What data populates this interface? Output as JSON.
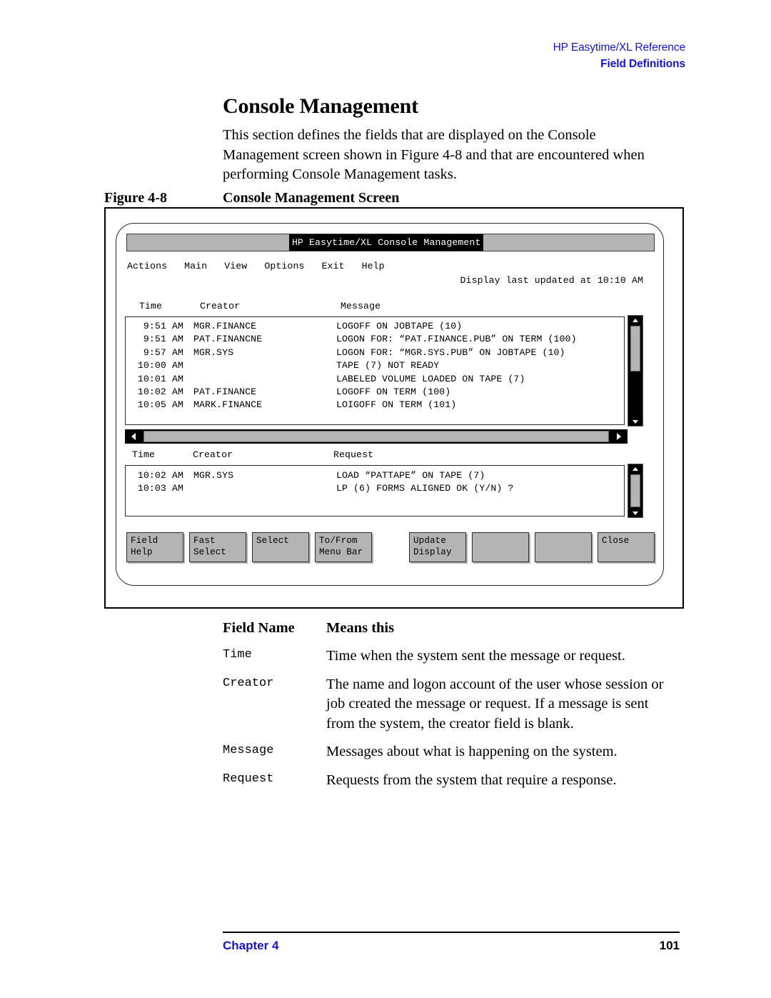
{
  "header": {
    "line1": "HP Easytime/XL Reference",
    "line2": "Field Definitions",
    "accent_color": "#1414d2"
  },
  "section": {
    "title": "Console Management",
    "intro": "This section defines the fields that are displayed on the Console Management screen shown in Figure 4-8 and that are encountered when performing Console Management tasks."
  },
  "figure": {
    "number_label": "Figure 4-8",
    "caption": "Console Management Screen"
  },
  "terminal": {
    "titlebar": "HP Easytime/XL Console Management",
    "menu_items": [
      "Actions",
      "Main",
      "View",
      "Options",
      "Exit",
      "Help"
    ],
    "status": "Display last updated at 10:10 AM",
    "message_columns": {
      "time": "Time",
      "creator": "Creator",
      "text": "Message"
    },
    "message_rows": [
      {
        "time": "9:51 AM",
        "creator": "MGR.FINANCE",
        "text": "LOGOFF ON JOBTAPE (10)"
      },
      {
        "time": "9:51 AM",
        "creator": "PAT.FINANCNE",
        "text": "LOGON FOR: “PAT.FINANCE.PUB” ON TERM (100)"
      },
      {
        "time": "9:57 AM",
        "creator": "MGR.SYS",
        "text": "LOGON FOR: “MGR.SYS.PUB” ON JOBTAPE (10)"
      },
      {
        "time": "10:00 AM",
        "creator": "",
        "text": "TAPE (7) NOT READY"
      },
      {
        "time": "10:01 AM",
        "creator": "",
        "text": "LABELED VOLUME LOADED ON TAPE (7)"
      },
      {
        "time": "10:02 AM",
        "creator": "PAT.FINANCE",
        "text": "LOGOFF ON TERM (100)"
      },
      {
        "time": "10:05 AM",
        "creator": "MARK.FINANCE",
        "text": "LOIGOFF ON TERM (101)"
      }
    ],
    "request_columns": {
      "time": "Time",
      "creator": "Creator",
      "text": "Request"
    },
    "request_rows": [
      {
        "time": "10:02 AM",
        "creator": "MGR.SYS",
        "text": "LOAD “PATTAPE” ON TAPE (7)"
      },
      {
        "time": "10:03 AM",
        "creator": "",
        "text": "LP (6) FORMS ALIGNED OK (Y/N) ?"
      }
    ],
    "function_keys": [
      {
        "line1": "Field",
        "line2": "Help"
      },
      {
        "line1": "Fast",
        "line2": "Select"
      },
      {
        "line1": "Select",
        "line2": ""
      },
      {
        "line1": "To/From",
        "line2": "Menu Bar"
      },
      {
        "line1": "Update",
        "line2": "Display"
      },
      {
        "line1": "",
        "line2": ""
      },
      {
        "line1": "",
        "line2": ""
      },
      {
        "line1": "Close",
        "line2": ""
      }
    ]
  },
  "definitions": {
    "head_name": "Field Name",
    "head_means": "Means this",
    "rows": [
      {
        "name": "Time",
        "desc": "Time when the system sent the message or request."
      },
      {
        "name": "Creator",
        "desc": "The name and logon account of the user whose session or job created the message or request. If a message is sent from the system, the creator field is blank."
      },
      {
        "name": "Message",
        "desc": "Messages about what is happening on the system."
      },
      {
        "name": "Request",
        "desc": "Requests from the system that require a response."
      }
    ]
  },
  "footer": {
    "chapter": "Chapter 4",
    "page_number": "101"
  }
}
